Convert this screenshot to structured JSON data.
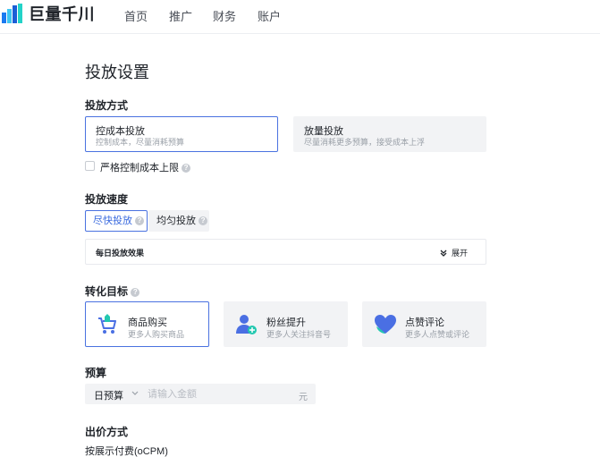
{
  "header": {
    "logo_text": "巨量千川",
    "nav": [
      "首页",
      "推广",
      "财务",
      "账户"
    ]
  },
  "page_title": "投放设置",
  "delivery_method": {
    "label": "投放方式",
    "options": [
      {
        "title": "控成本投放",
        "desc": "控制成本，尽量消耗预算",
        "selected": true
      },
      {
        "title": "放量投放",
        "desc": "尽量消耗更多预算，接受成本上浮",
        "selected": false
      }
    ],
    "strict_cost_label": "严格控制成本上限"
  },
  "delivery_speed": {
    "label": "投放速度",
    "options": [
      {
        "title": "尽快投放",
        "selected": true
      },
      {
        "title": "均匀投放",
        "selected": false
      }
    ],
    "daily_effect_label": "每日投放效果",
    "expand_label": "展开"
  },
  "conversion_goal": {
    "label": "转化目标",
    "options": [
      {
        "title": "商品购买",
        "desc": "更多人购买商品",
        "icon": "cart-icon",
        "selected": true
      },
      {
        "title": "粉丝提升",
        "desc": "更多人关注抖音号",
        "icon": "add-user-icon",
        "selected": false
      },
      {
        "title": "点赞评论",
        "desc": "更多人点赞或评论",
        "icon": "heart-icon",
        "selected": false
      }
    ]
  },
  "budget": {
    "label": "预算",
    "type_value": "日预算",
    "placeholder": "请输入金额",
    "unit": "元"
  },
  "bidding": {
    "label": "出价方式",
    "value": "按展示付费(oCPM)"
  },
  "colors": {
    "accent": "#4a72e0",
    "muted_bg": "#f2f3f5",
    "text": "#1f2329",
    "subtext": "#9aa0a8"
  }
}
